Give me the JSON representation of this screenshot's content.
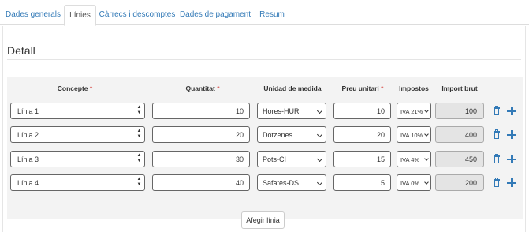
{
  "tabs": [
    {
      "label": "Dades generals"
    },
    {
      "label": "Línies"
    },
    {
      "label": "Càrrecs i descomptes"
    },
    {
      "label": "Dades de pagament"
    },
    {
      "label": "Resum"
    }
  ],
  "active_tab": "Línies",
  "section_title": "Detall",
  "columns": {
    "concepte": "Concepte",
    "quantitat": "Quantitat",
    "unitat": "Unidad de medida",
    "preu": "Preu unitari",
    "impostos": "Impostos",
    "import_brut": "Import brut",
    "required_mark": "*"
  },
  "rows": [
    {
      "concepte": "Línia 1",
      "quantitat": "10",
      "unitat": "Hores-HUR",
      "preu": "10",
      "iva": "IVA 21%",
      "import_brut": "100"
    },
    {
      "concepte": "Línia 2",
      "quantitat": "20",
      "unitat": "Dotzenes",
      "preu": "20",
      "iva": "IVA 10%",
      "import_brut": "400"
    },
    {
      "concepte": "Línia 3",
      "quantitat": "30",
      "unitat": "Pots-CI",
      "preu": "15",
      "iva": "IVA 4%",
      "import_brut": "450"
    },
    {
      "concepte": "Línia 4",
      "quantitat": "40",
      "unitat": "Safates-DS",
      "preu": "5",
      "iva": "IVA 0%",
      "import_brut": "200"
    }
  ],
  "add_line_label": "Afegir línia",
  "icons": {
    "delete": "trash-icon",
    "add": "plus-icon",
    "spinner": "spinner-arrows-icon",
    "dropdown": "chevron-down-icon"
  },
  "colors": {
    "link": "#337ab7",
    "required": "#d9534f",
    "grid_bg": "#f3f3f3"
  }
}
